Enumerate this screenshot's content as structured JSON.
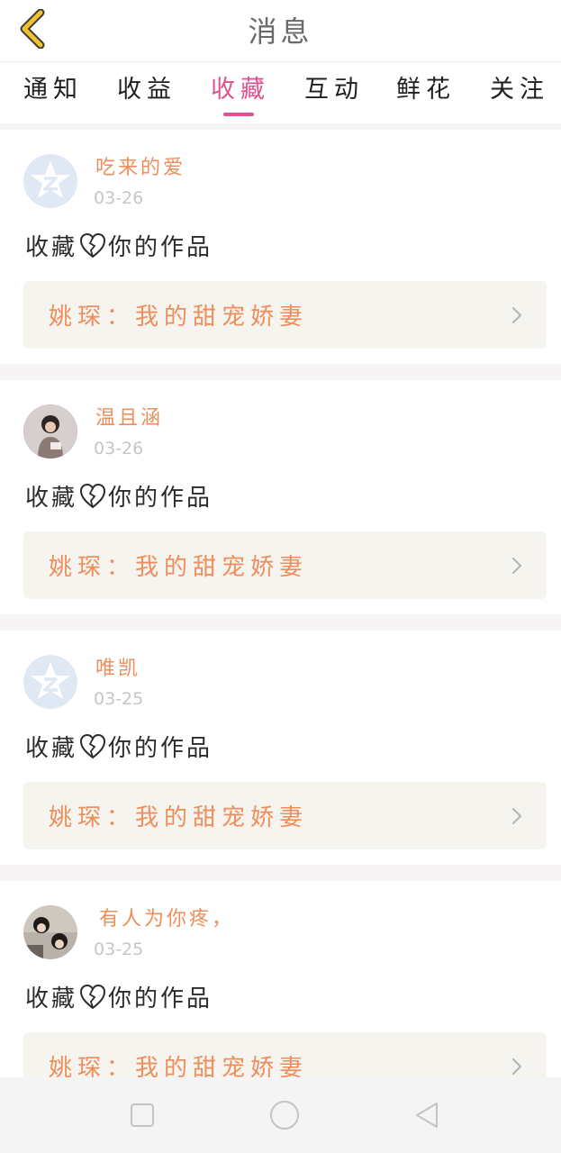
{
  "header": {
    "title": "消息",
    "back_icon": "chevron-left-icon"
  },
  "tabs": [
    {
      "label": "通知"
    },
    {
      "label": "收益"
    },
    {
      "label": "收藏",
      "active": true
    },
    {
      "label": "互动"
    },
    {
      "label": "鲜花"
    },
    {
      "label": "关注"
    }
  ],
  "messages": [
    {
      "username": "吃来的爱",
      "date": "03-26",
      "action_before": "收藏",
      "action_after": "你的作品",
      "work_title": "姚琛：我的甜宠娇妻",
      "avatar": "default-star-avatar"
    },
    {
      "username": "温且涵",
      "date": "03-26",
      "action_before": "收藏",
      "action_after": "你的作品",
      "work_title": "姚琛：我的甜宠娇妻",
      "avatar": "photo-avatar-child"
    },
    {
      "username": "唯凯",
      "date": "03-25",
      "action_before": "收藏",
      "action_after": "你的作品",
      "work_title": "姚琛：我的甜宠娇妻",
      "avatar": "default-star-avatar"
    },
    {
      "username": "有人为你疼，",
      "date": "03-25",
      "action_before": "收藏",
      "action_after": "你的作品",
      "work_title": "姚琛：我的甜宠娇妻",
      "avatar": "photo-avatar-couple"
    }
  ],
  "colors": {
    "accent": "#e0518f",
    "name": "#ef8e5c",
    "date": "#c6c6c6",
    "link_bg": "#f5f4ee",
    "back_arrow": "#f2c12e"
  },
  "navbar": {
    "icons": [
      "square-icon",
      "circle-icon",
      "triangle-back-icon"
    ]
  }
}
